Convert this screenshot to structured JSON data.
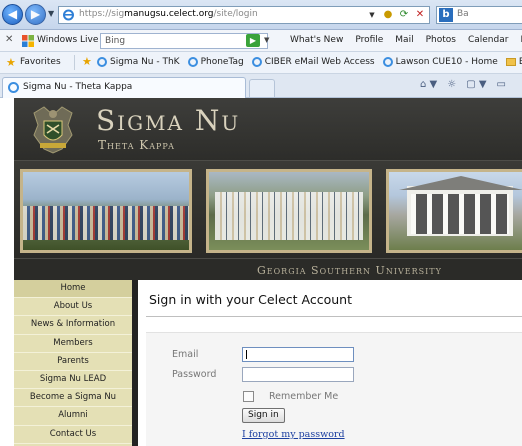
{
  "browser": {
    "address_prefix": "https://sig",
    "address_domain": "manugsu.celect.org",
    "address_path": "/site/login",
    "search_placeholder": "Ba"
  },
  "windows_live_bar": {
    "label": "Windows Live",
    "search_value": "Bing",
    "links": [
      "What's New",
      "Profile",
      "Mail",
      "Photos",
      "Calendar",
      "MS"
    ]
  },
  "favorites_bar": {
    "label": "Favorites",
    "links": [
      "Sigma Nu - ThK",
      "PhoneTag",
      "CIBER eMail Web Access",
      "Lawson CUE10 - Home",
      "Bank"
    ]
  },
  "tab": {
    "title": "Sigma Nu - Theta Kappa"
  },
  "site": {
    "name": "Sigma Nu",
    "chapter": "Theta Kappa",
    "university": "Georgia Southern University"
  },
  "sidebar": {
    "items": [
      {
        "label": "Home"
      },
      {
        "label": "About Us"
      },
      {
        "label": "News & Information"
      },
      {
        "label": "Members"
      },
      {
        "label": "Parents"
      },
      {
        "label": "Sigma Nu LEAD"
      },
      {
        "label": "Become a Sigma Nu"
      },
      {
        "label": "Alumni"
      },
      {
        "label": "Contact Us"
      }
    ]
  },
  "login": {
    "title": "Sign in with your Celect Account",
    "email_label": "Email",
    "password_label": "Password",
    "remember_label": "Remember Me",
    "signin_label": "Sign in",
    "forgot_label": "I forgot my password"
  }
}
